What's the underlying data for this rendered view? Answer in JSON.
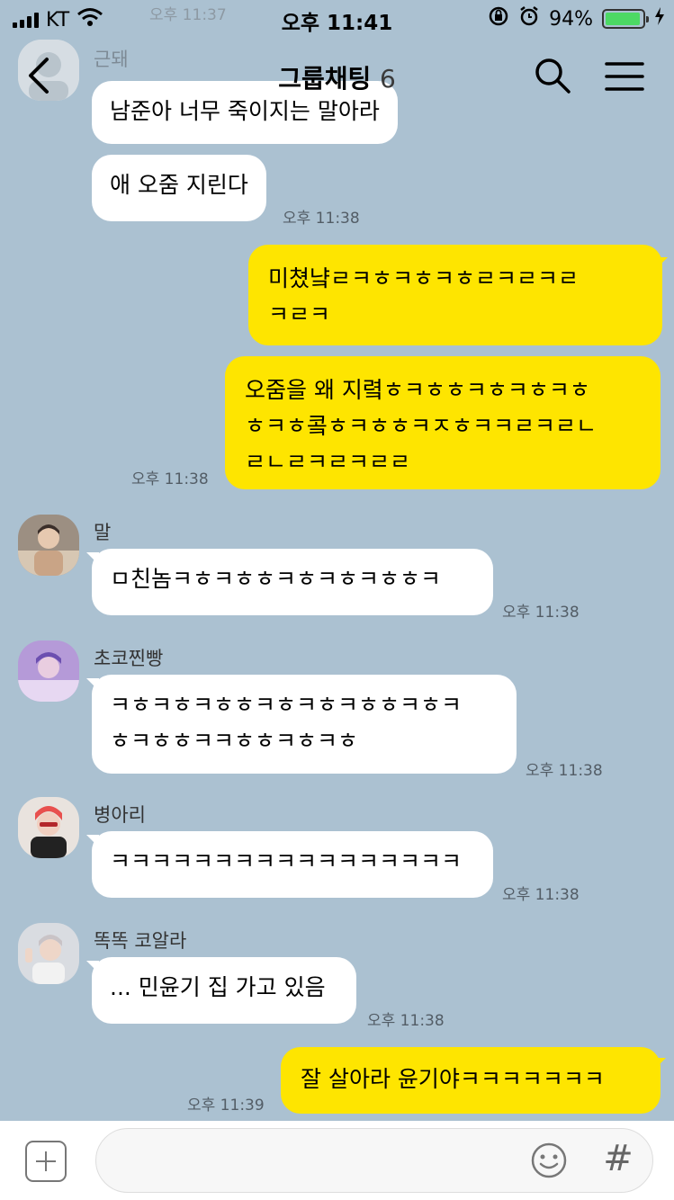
{
  "status_bar": {
    "carrier": "KT",
    "time": "오후 11:41",
    "battery_percent": "94%",
    "battery_level": 0.94
  },
  "header": {
    "title": "그룹채팅",
    "member_count": "6"
  },
  "colors": {
    "chat_background": "#abc1d1",
    "my_bubble": "#fee500",
    "other_bubble": "#ffffff"
  },
  "messages": [
    {
      "sender": "근돼",
      "lines": [
        "남준아 너무 죽이지는 말아라"
      ],
      "time": "오후 11:37",
      "side": "in"
    },
    {
      "lines": [
        "애 오줌 지린다"
      ],
      "time": "오후 11:38",
      "side": "in"
    },
    {
      "lines": [
        "미쳤냨ㄹㅋㅎㅋㅎㅋㅎㄹㅋㄹㅋㄹ",
        "ㅋㄹㅋ"
      ],
      "side": "out"
    },
    {
      "lines": [
        "오줌을 왜 지렼ㅎㅋㅎㅎㅋㅎㅋㅎㅋㅎ",
        "ㅎㅋㅎ콬ㅎㅋㅎㅎㅋㅈㅎㅋㅋㄹㅋㄹㄴ",
        "ㄹㄴㄹㅋㄹㅋㄹㄹ"
      ],
      "time": "오후 11:38",
      "side": "out"
    },
    {
      "sender": "말",
      "lines": [
        "ㅁ친놈ㅋㅎㅋㅎㅎㅋㅎㅋㅎㅋㅎㅎㅋ"
      ],
      "time": "오후 11:38",
      "side": "in"
    },
    {
      "sender": "초코찐빵",
      "lines": [
        "ㅋㅎㅋㅎㅋㅎㅎㅋㅎㅋㅎㅋㅎㅎㅋㅎㅋ",
        "ㅎㅋㅎㅎㅋㅋㅎㅎㅋㅎㅋㅎ"
      ],
      "time": "오후 11:38",
      "side": "in"
    },
    {
      "sender": "병아리",
      "lines": [
        "ㅋㅋㅋㅋㅋㅋㅋㅋㅋㅋㅋㅋㅋㅋㅋㅋㅋ"
      ],
      "time": "오후 11:38",
      "side": "in"
    },
    {
      "sender": "똑똑 코알라",
      "lines": [
        "... 민윤기 집 가고 있음"
      ],
      "time": "오후 11:38",
      "side": "in"
    },
    {
      "lines": [
        "잘 살아라 윤기야ㅋㅋㅋㅋㅋㅋㅋ"
      ],
      "time": "오후 11:39",
      "side": "out"
    }
  ],
  "input_bar": {
    "plus_icon": "plus-icon",
    "emoji_icon": "emoji-icon",
    "hash_label": "#"
  }
}
